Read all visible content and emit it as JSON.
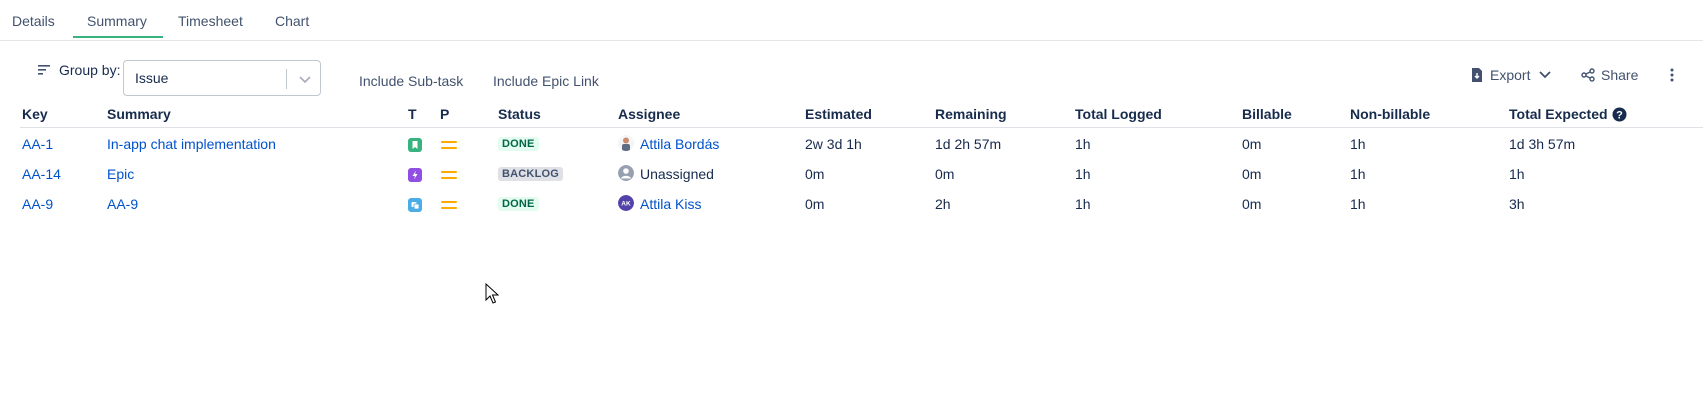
{
  "tabs": [
    {
      "label": "Details"
    },
    {
      "label": "Summary",
      "active": true
    },
    {
      "label": "Timesheet"
    },
    {
      "label": "Chart"
    }
  ],
  "toolbar": {
    "group_by_label": "Group by:",
    "group_by_value": "Issue",
    "include_subtask": "Include Sub-task",
    "include_epic_link": "Include Epic Link",
    "export_label": "Export",
    "share_label": "Share"
  },
  "table": {
    "headers": {
      "key": "Key",
      "summary": "Summary",
      "type": "T",
      "priority": "P",
      "status": "Status",
      "assignee": "Assignee",
      "estimated": "Estimated",
      "remaining": "Remaining",
      "total_logged": "Total Logged",
      "billable": "Billable",
      "non_billable": "Non-billable",
      "total_expected": "Total Expected"
    },
    "rows": [
      {
        "key": "AA-1",
        "summary": "In-app chat implementation",
        "type_icon": "story-icon",
        "type_color": "#36b37e",
        "status": "DONE",
        "status_style": "done",
        "assignee": "Attila Bordás",
        "assignee_linked": true,
        "estimated": "2w 3d 1h",
        "remaining": "1d 2h 57m",
        "total_logged": "1h",
        "billable": "0m",
        "non_billable": "1h",
        "total_expected": "1d 3h 57m"
      },
      {
        "key": "AA-14",
        "summary": "Epic",
        "type_icon": "epic-icon",
        "type_color": "#904ee2",
        "status": "BACKLOG",
        "status_style": "backlog",
        "assignee": "Unassigned",
        "assignee_linked": false,
        "estimated": "0m",
        "remaining": "0m",
        "total_logged": "1h",
        "billable": "0m",
        "non_billable": "1h",
        "total_expected": "1h"
      },
      {
        "key": "AA-9",
        "summary": "AA-9",
        "type_icon": "task-icon",
        "type_color": "#4bade8",
        "status": "DONE",
        "status_style": "done",
        "assignee": "Attila Kiss",
        "assignee_initials": "AK",
        "assignee_linked": true,
        "estimated": "0m",
        "remaining": "2h",
        "total_logged": "1h",
        "billable": "0m",
        "non_billable": "1h",
        "total_expected": "3h"
      }
    ]
  }
}
